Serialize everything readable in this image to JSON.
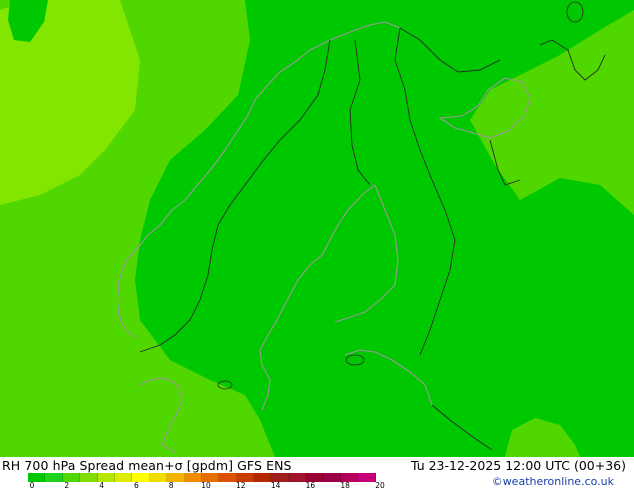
{
  "title": {
    "left": "RH 700 hPa Spread mean+σ [gpdm] GFS ENS",
    "right": "Tu 23-12-2025 12:00 UTC (00+36)"
  },
  "credit": "©weatheronline.co.uk",
  "legend": {
    "colors": [
      "#00c800",
      "#1ed21e",
      "#50d700",
      "#82dc00",
      "#b4e600",
      "#dceb00",
      "#ffff00",
      "#f0dc00",
      "#f0b400",
      "#f08c00",
      "#e66e00",
      "#dc5000",
      "#c83c00",
      "#b42800",
      "#a01e1e",
      "#a0142d",
      "#960032",
      "#9b0046",
      "#b4005a",
      "#c80078"
    ],
    "tick_labels": [
      "0",
      "2",
      "4",
      "6",
      "8",
      "10",
      "12",
      "14",
      "16",
      "18",
      "20"
    ]
  },
  "map": {
    "colors": {
      "low": "#00c800",
      "mid": "#50d700",
      "high": "#82e600",
      "coast": "#9a9a9a",
      "border": "#2a2a2a"
    }
  }
}
